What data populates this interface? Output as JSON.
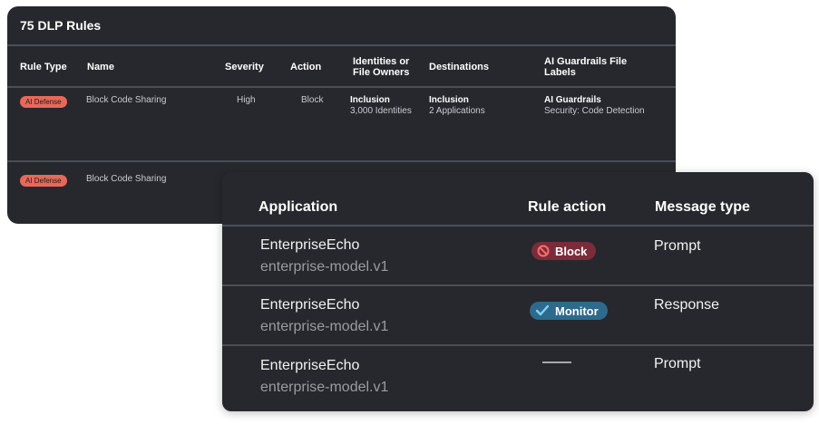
{
  "rules_panel": {
    "title": "75 DLP Rules",
    "headers": {
      "rule_type": "Rule Type",
      "name": "Name",
      "severity": "Severity",
      "action": "Action",
      "identities": "Identities or File Owners",
      "destinations": "Destinations",
      "labels": "AI Guardrails File Labels"
    },
    "rows": [
      {
        "rule_type": "AI Defense",
        "name": "Block Code Sharing",
        "severity": "High",
        "action": "Block",
        "identities_title": "Inclusion",
        "identities_value": "3,000 Identities",
        "destinations_title": "Inclusion",
        "destinations_value": "2 Applications",
        "labels_title": "AI Guardrails",
        "labels_value": "Security: Code Detection"
      },
      {
        "rule_type": "AI Defense",
        "name": "Block Code Sharing"
      }
    ]
  },
  "apps_panel": {
    "headers": {
      "application": "Application",
      "rule_action": "Rule action",
      "message_type": "Message type"
    },
    "rows": [
      {
        "app": "EnterpriseEcho",
        "model": "enterprise-model.v1",
        "action": "Block",
        "action_icon": "block-icon",
        "message_type": "Prompt"
      },
      {
        "app": "EnterpriseEcho",
        "model": "enterprise-model.v1",
        "action": "Monitor",
        "action_icon": "check-icon",
        "message_type": "Response"
      },
      {
        "app": "EnterpriseEcho",
        "model": "enterprise-model.v1",
        "action": "",
        "action_icon": "dash",
        "message_type": "Prompt"
      }
    ]
  },
  "colors": {
    "panel_bg": "#26282d",
    "ai_defense_pill": "#e8685a",
    "block_badge": "#7b2c3a",
    "monitor_badge": "#2d6a8c"
  }
}
